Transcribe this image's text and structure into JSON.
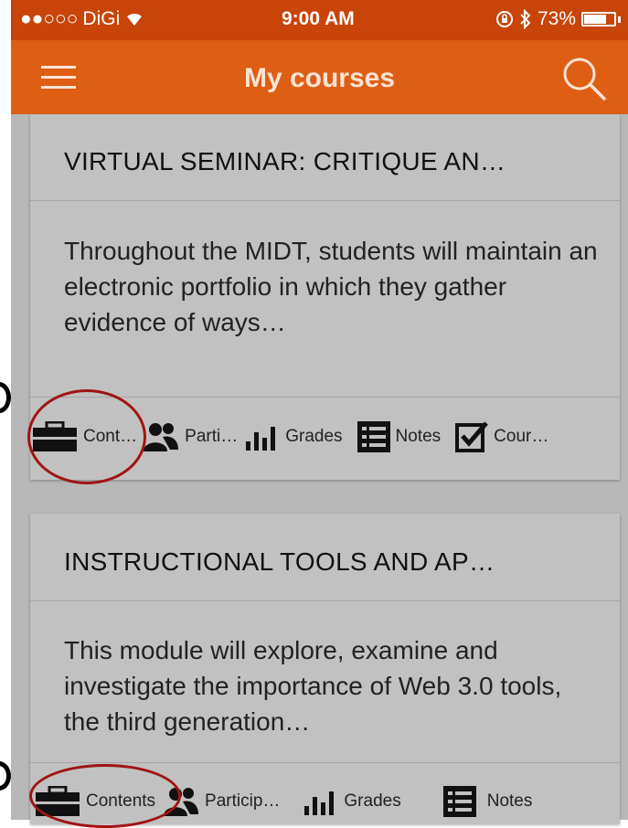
{
  "status": {
    "carrier": "DiGi",
    "time": "9:00 AM",
    "battery": "73%"
  },
  "app_bar": {
    "title": "My courses"
  },
  "courses": [
    {
      "title": "VIRTUAL SEMINAR: CRITIQUE AN…",
      "description": "Throughout the MIDT, students will maintain an electronic portfolio in which they gather evidence of ways…",
      "actions": {
        "contents": "Cont…",
        "participants": "Parti…",
        "grades": "Grades",
        "notes": "Notes",
        "completion": "Cour…"
      }
    },
    {
      "title": "INSTRUCTIONAL TOOLS AND AP…",
      "description": "This module will explore, examine and investigate the importance of Web 3.0 tools, the third generation…",
      "actions": {
        "contents": "Contents",
        "participants": "Particip…",
        "grades": "Grades",
        "notes": "Notes"
      }
    }
  ],
  "colors": {
    "status_bar": "#c84408",
    "app_bar": "#de5e14",
    "annotation": "#a01414"
  }
}
